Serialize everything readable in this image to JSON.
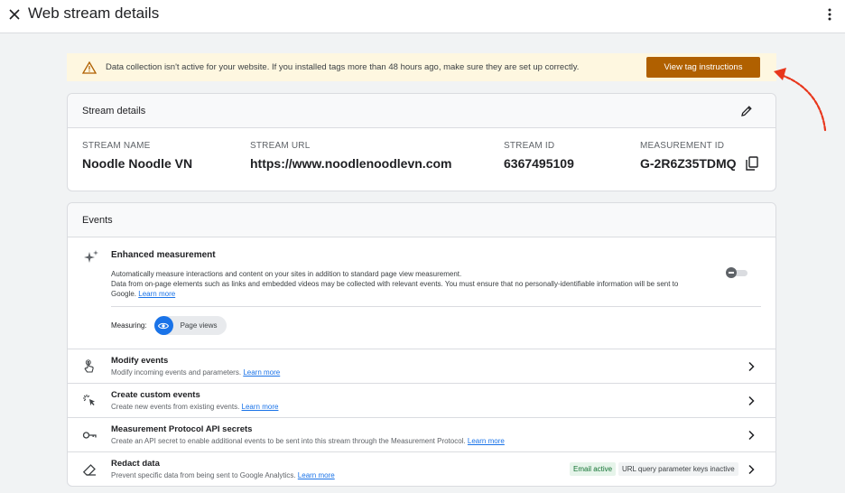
{
  "header": {
    "title": "Web stream details",
    "close_icon": "close-icon",
    "more_icon": "more-vert-icon"
  },
  "banner": {
    "message": "Data collection isn't active for your website. If you installed tags more than 48 hours ago, make sure they are set up correctly.",
    "button_label": "View tag instructions",
    "icon": "warning-icon",
    "color": "#b06000"
  },
  "stream_details": {
    "header": "Stream details",
    "name_label": "STREAM NAME",
    "name_value": "Noodle Noodle VN",
    "url_label": "STREAM URL",
    "url_value": "https://www.noodlenoodlevn.com",
    "id_label": "STREAM ID",
    "id_value": "6367495109",
    "measurement_label": "MEASUREMENT ID",
    "measurement_value": "G-2R6Z35TDMQ"
  },
  "events": {
    "header": "Events",
    "enhanced": {
      "title": "Enhanced measurement",
      "desc_line1": "Automatically measure interactions and content on your sites in addition to standard page view measurement.",
      "desc_line2": "Data from on-page elements such as links and embedded videos may be collected with relevant events. You must ensure that no personally-identifiable information will be sent to",
      "desc_line3": "Google.",
      "learn_more": "Learn more",
      "enabled": false,
      "measuring_label": "Measuring:",
      "chip_label": "Page views"
    },
    "rows": [
      {
        "title": "Modify events",
        "desc": "Modify incoming events and parameters.",
        "link": "Learn more",
        "icon": "touch-icon"
      },
      {
        "title": "Create custom events",
        "desc": "Create new events from existing events.",
        "link": "Learn more",
        "icon": "sparkle-click-icon"
      },
      {
        "title": "Measurement Protocol API secrets",
        "desc": "Create an API secret to enable additional events to be sent into this stream through the Measurement Protocol.",
        "link": "Learn more",
        "icon": "key-icon"
      },
      {
        "title": "Redact data",
        "desc": "Prevent specific data from being sent to Google Analytics.",
        "link": "Learn more",
        "icon": "eraser-icon",
        "badge_email": "Email active",
        "badge_url": "URL query parameter keys inactive"
      }
    ]
  },
  "colors": {
    "accent": "#1a73e8",
    "warning_bg": "#fef7e0",
    "annotation_arrow": "#e8361c"
  }
}
